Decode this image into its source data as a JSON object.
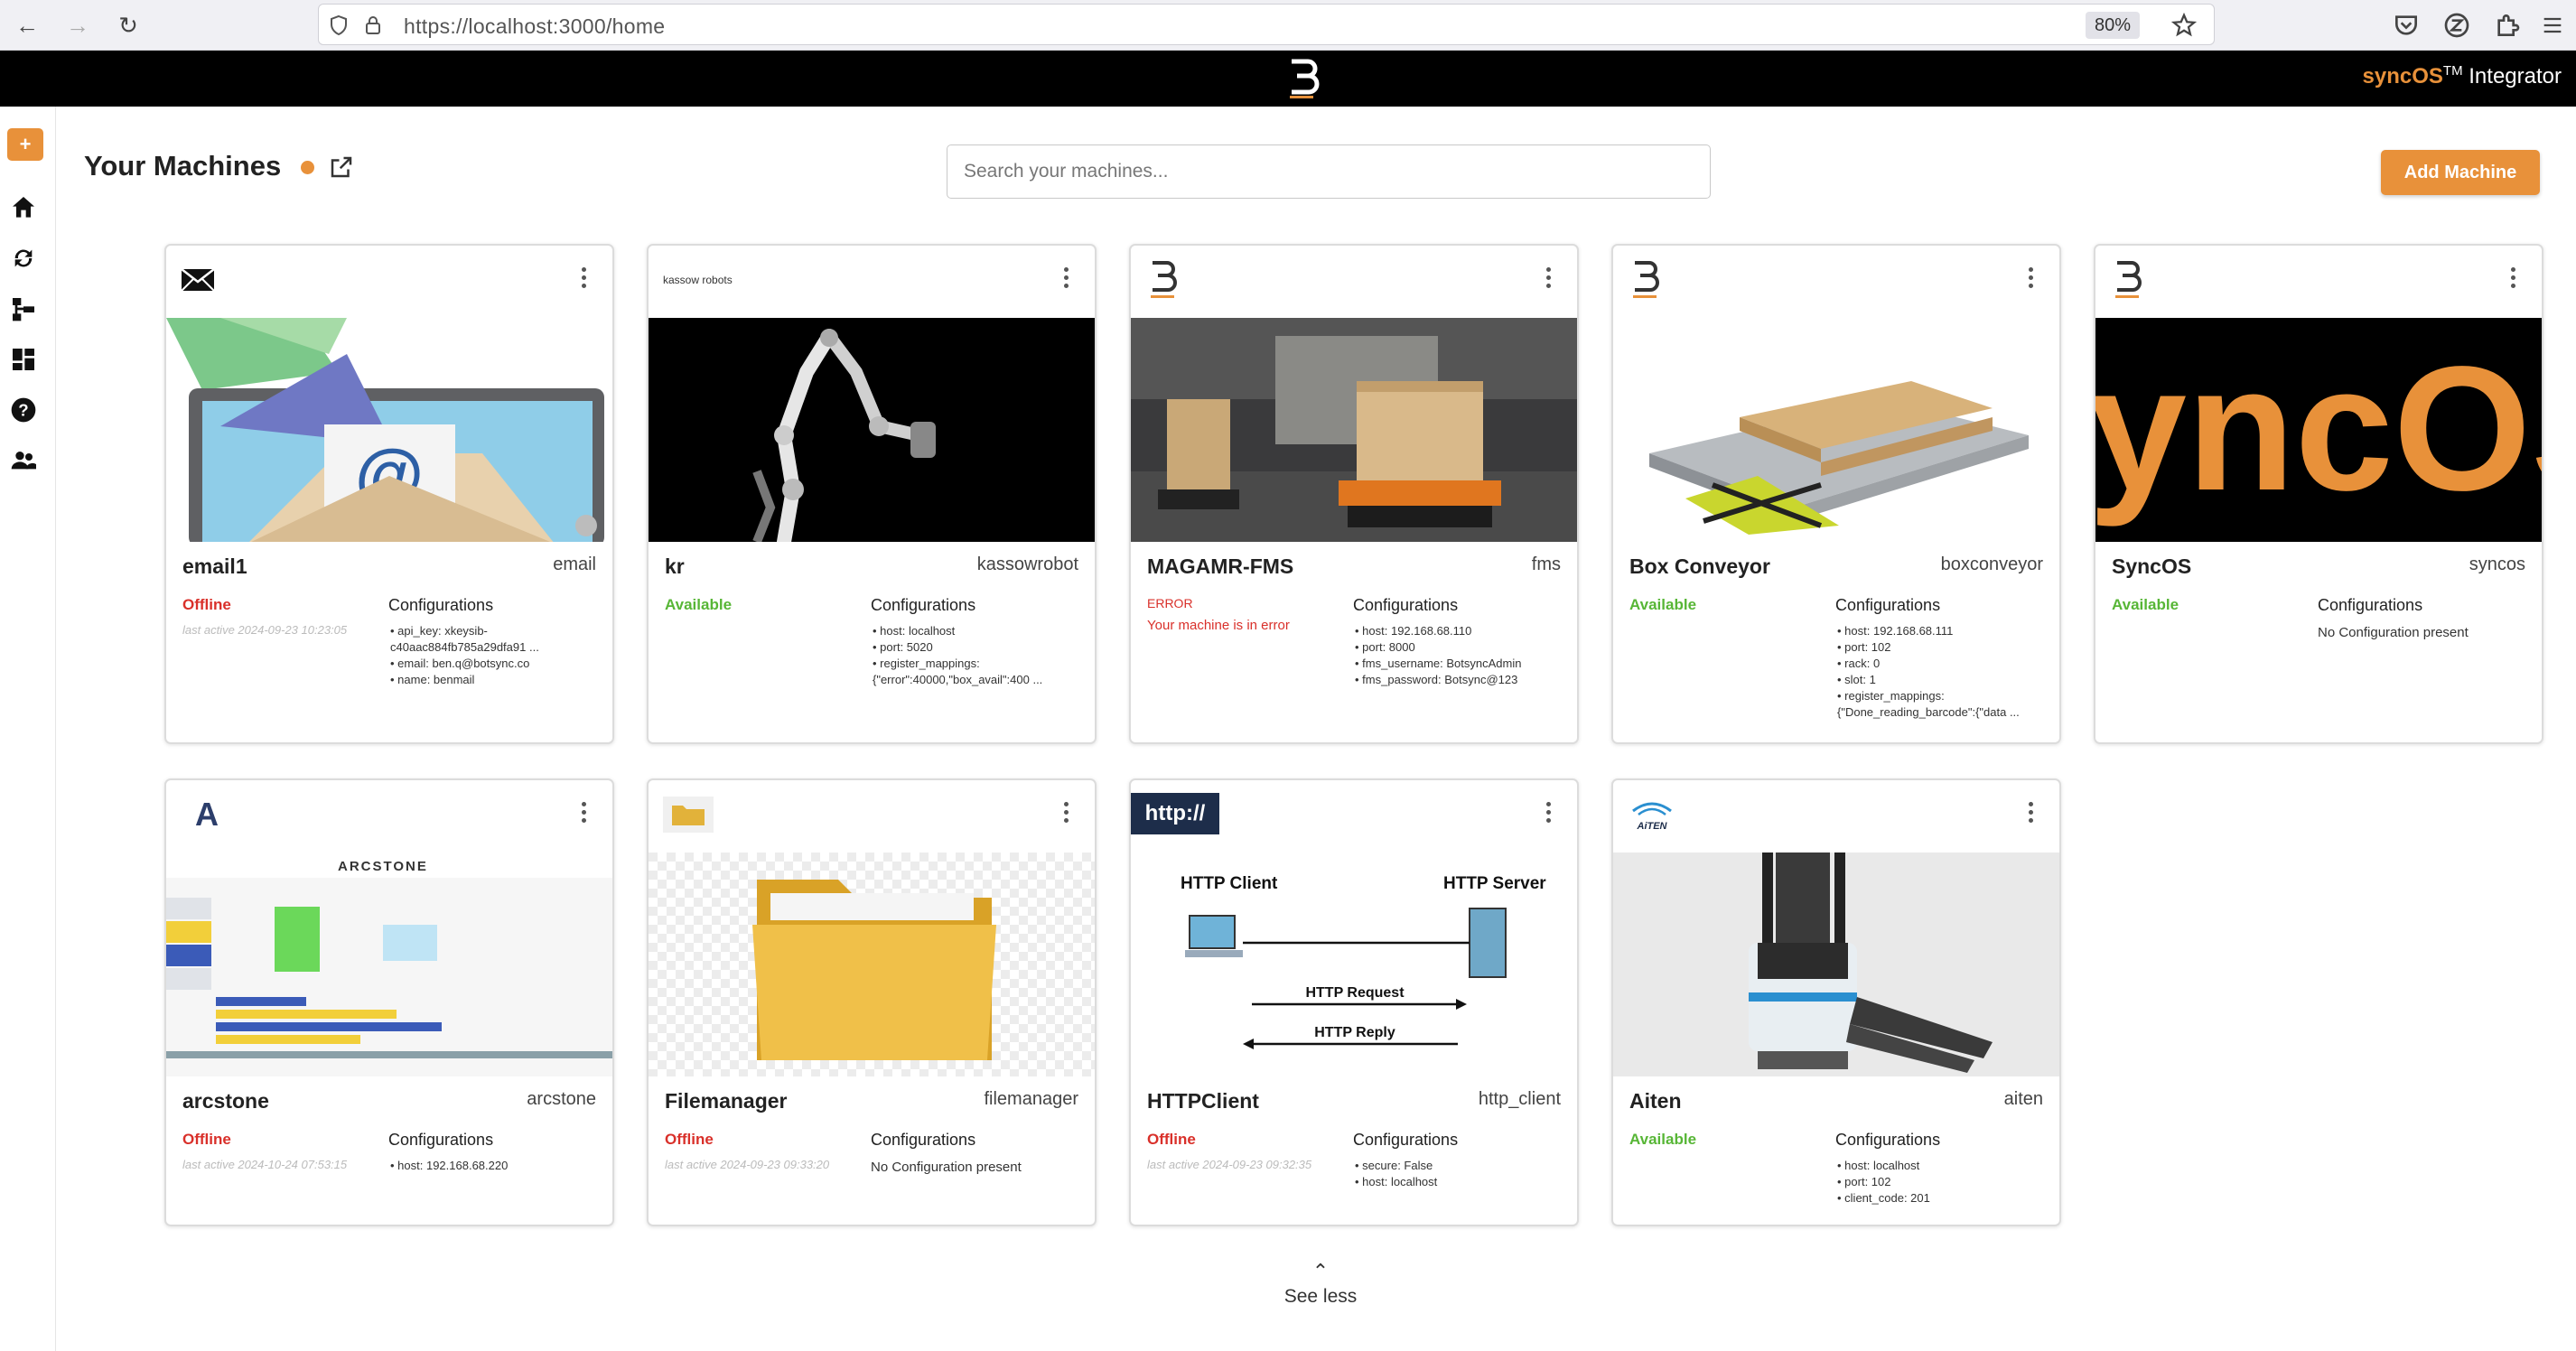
{
  "browser": {
    "url": "https://localhost:3000/home",
    "zoom": "80%"
  },
  "header": {
    "brand_sync": "syncOS",
    "brand_tm": "TM",
    "brand_rest": " Integrator"
  },
  "sidebar": {
    "plus_label": "+",
    "icons": [
      "home-icon",
      "sync-icon",
      "hierarchy-icon",
      "dashboard-icon",
      "help-icon",
      "users-icon"
    ]
  },
  "page": {
    "title": "Your Machines",
    "search_placeholder": "Search your machines...",
    "add_button": "Add Machine",
    "see_less": "See less"
  },
  "machines": [
    {
      "name": "email1",
      "type": "email",
      "status": "Offline",
      "last_active": "last active 2024-09-23 10:23:05",
      "config_title": "Configurations",
      "configs": [
        "api_key: xkeysib-c40aac884fb785a29dfa91 ...",
        "email: ben.q@botsync.co",
        "name: benmail"
      ]
    },
    {
      "name": "kr",
      "type": "kassowrobot",
      "status": "Available",
      "logo_text": "kassow robots",
      "config_title": "Configurations",
      "configs": [
        "host: localhost",
        "port: 5020",
        "register_mappings: {\"error\":40000,\"box_avail\":400 ..."
      ]
    },
    {
      "name": "MAGAMR-FMS",
      "type": "fms",
      "status": "ERROR",
      "error_message": "Your machine is in error",
      "config_title": "Configurations",
      "configs": [
        "host: 192.168.68.110",
        "port: 8000",
        "fms_username: BotsyncAdmin",
        "fms_password: Botsync@123"
      ]
    },
    {
      "name": "Box Conveyor",
      "type": "boxconveyor",
      "status": "Available",
      "config_title": "Configurations",
      "configs": [
        "host: 192.168.68.111",
        "port: 102",
        "rack: 0",
        "slot: 1",
        "register_mappings: {\"Done_reading_barcode\":{\"data ..."
      ]
    },
    {
      "name": "SyncOS",
      "type": "syncos",
      "status": "Available",
      "image_text": "yncOS",
      "config_title": "Configurations",
      "config_none": "No Configuration present"
    },
    {
      "name": "arcstone",
      "type": "arcstone",
      "status": "Offline",
      "logo_text": "A",
      "image_text": "ARCSTONE",
      "last_active": "last active 2024-10-24 07:53:15",
      "config_title": "Configurations",
      "configs": [
        "host: 192.168.68.220"
      ]
    },
    {
      "name": "Filemanager",
      "type": "filemanager",
      "status": "Offline",
      "last_active": "last active 2024-09-23 09:33:20",
      "config_title": "Configurations",
      "config_none": "No Configuration present"
    },
    {
      "name": "HTTPClient",
      "type": "http_client",
      "status": "Offline",
      "logo_text": "http://",
      "diagram": {
        "client": "HTTP Client",
        "server": "HTTP Server",
        "request": "HTTP Request",
        "reply": "HTTP Reply"
      },
      "last_active": "last active 2024-09-23 09:32:35",
      "config_title": "Configurations",
      "configs": [
        "secure: False",
        "host: localhost"
      ]
    },
    {
      "name": "Aiten",
      "type": "aiten",
      "status": "Available",
      "logo_text": "AiTEN",
      "config_title": "Configurations",
      "configs": [
        "host: localhost",
        "port: 102",
        "client_code: 201"
      ]
    }
  ],
  "colors": {
    "accent": "#e8913a",
    "offline": "#d9302a",
    "available": "#57b636",
    "header_bg": "#000000"
  }
}
